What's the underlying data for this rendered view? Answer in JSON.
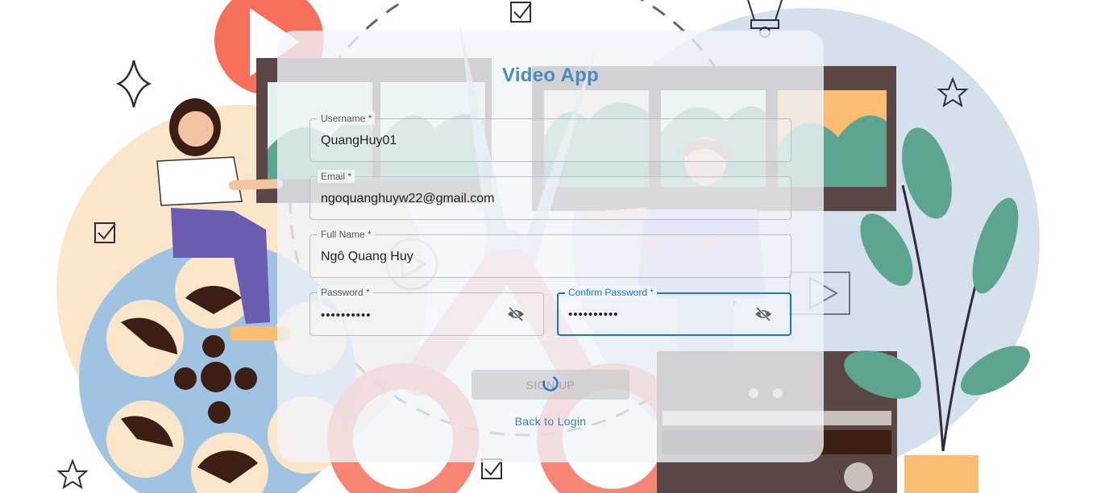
{
  "app": {
    "title": "Video App"
  },
  "form": {
    "username": {
      "label": "Username *",
      "value": "QuangHuy01"
    },
    "email": {
      "label": "Email *",
      "value": "ngoquanghuyw22@gmail.com"
    },
    "full_name": {
      "label": "Full Name *",
      "value": "Ngô Quang Huy"
    },
    "password": {
      "label": "Password *",
      "value": "••••••••••",
      "icon": "eye-off-icon"
    },
    "confirm_password": {
      "label": "Confirm Password *",
      "value": "••••••••••",
      "icon": "eye-off-icon",
      "focused": true
    },
    "submit": {
      "label": "SIGN UP",
      "state": "loading",
      "disabled": true
    },
    "back_link": "Back to Login"
  },
  "colors": {
    "accent": "#1976d2",
    "title": "#4a8ac0",
    "link": "#3f7fb8",
    "button_bg": "#c8c8c8"
  }
}
